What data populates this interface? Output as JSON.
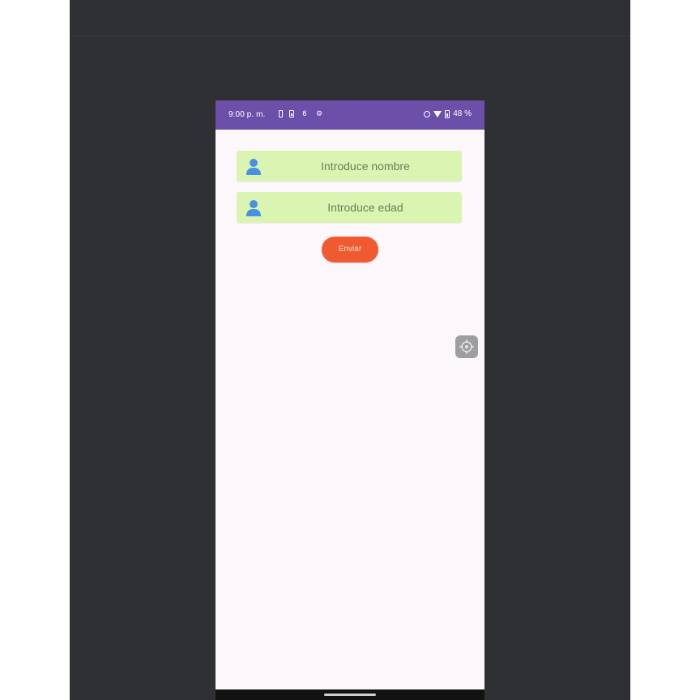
{
  "status_bar": {
    "time": "9:00 p. m.",
    "battery_percent": "48 %",
    "left_icons": [
      "sim-icon",
      "battery-saver-icon",
      "sync-off-icon",
      "settings-icon"
    ],
    "right_icons": [
      "circle-icon",
      "wifi-icon",
      "battery-icon"
    ],
    "color": "#6c4fa8"
  },
  "form": {
    "name_placeholder": "Introduce nombre",
    "age_placeholder": "Introduce edad",
    "field_color": "#daf5b1",
    "field_icon": "person-icon",
    "submit_label": "Enviar",
    "submit_color": "#ef5a30"
  },
  "floating_button": {
    "icon": "target-icon"
  }
}
